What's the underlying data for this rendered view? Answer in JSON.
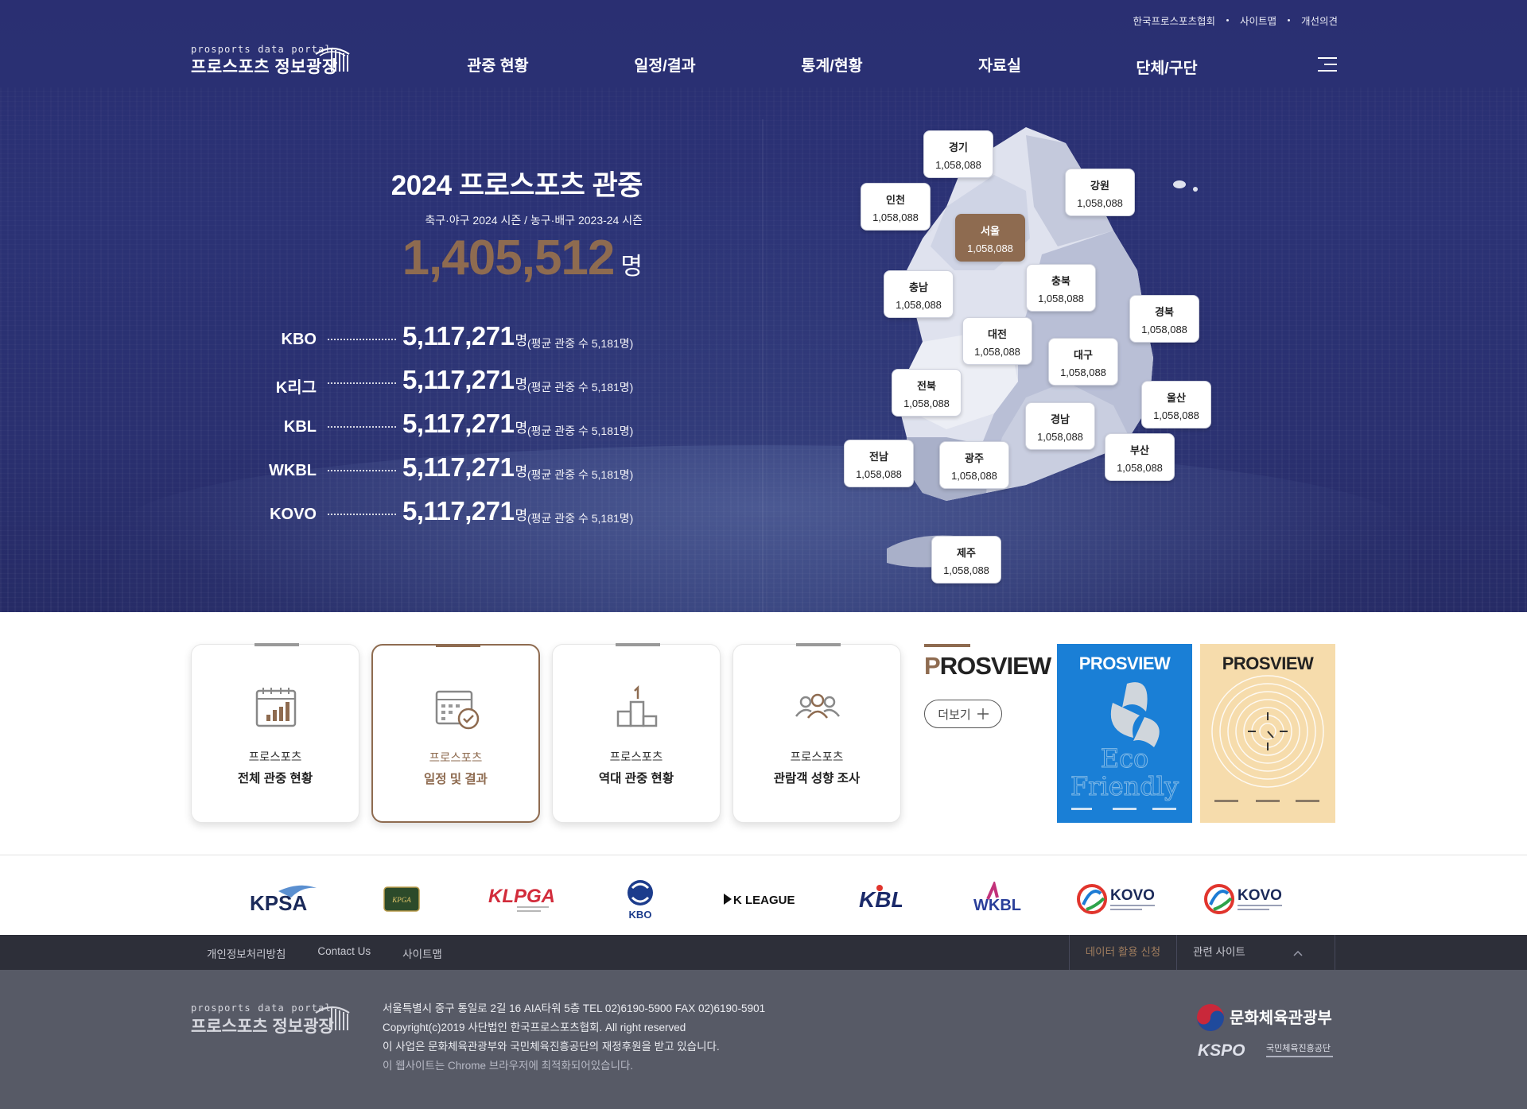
{
  "topbar": {
    "links": [
      "한국프로스포츠협회",
      "사이트맵",
      "개선의견"
    ]
  },
  "logo": {
    "small": "prosports data portal",
    "big": "프로스포츠 정보광장"
  },
  "gnb": [
    "관중 현황",
    "일정/결과",
    "통계/현황",
    "자료실",
    "단체/구단"
  ],
  "hero": {
    "title": "2024 프로스포츠 관중",
    "subtitle": "축구·야구 2024 시즌 / 농구·배구 2023-24 시즌",
    "total": "1,405,512",
    "total_unit": "명",
    "leagues": [
      {
        "name": "KBO",
        "value": "5,117,271",
        "unit": "명",
        "avg": "(평균 관중 수  5,181명)"
      },
      {
        "name": "K리그",
        "value": "5,117,271",
        "unit": "명",
        "avg": "(평균 관중 수  5,181명)"
      },
      {
        "name": "KBL",
        "value": "5,117,271",
        "unit": "명",
        "avg": "(평균 관중 수  5,181명)"
      },
      {
        "name": "WKBL",
        "value": "5,117,271",
        "unit": "명",
        "avg": "(평균 관중 수  5,181명)"
      },
      {
        "name": "KOVO",
        "value": "5,117,271",
        "unit": "명",
        "avg": "(평균 관중 수  5,181명)"
      }
    ],
    "regions": [
      {
        "name": "경기",
        "value": "1,058,088"
      },
      {
        "name": "강원",
        "value": "1,058,088"
      },
      {
        "name": "인천",
        "value": "1,058,088"
      },
      {
        "name": "서울",
        "value": "1,058,088",
        "active": true
      },
      {
        "name": "충남",
        "value": "1,058,088"
      },
      {
        "name": "충북",
        "value": "1,058,088"
      },
      {
        "name": "경북",
        "value": "1,058,088"
      },
      {
        "name": "대전",
        "value": "1,058,088"
      },
      {
        "name": "대구",
        "value": "1,058,088"
      },
      {
        "name": "전북",
        "value": "1,058,088"
      },
      {
        "name": "울산",
        "value": "1,058,088"
      },
      {
        "name": "경남",
        "value": "1,058,088"
      },
      {
        "name": "전남",
        "value": "1,058,088"
      },
      {
        "name": "광주",
        "value": "1,058,088"
      },
      {
        "name": "부산",
        "value": "1,058,088"
      },
      {
        "name": "제주",
        "value": "1,058,088"
      }
    ]
  },
  "quick_menu": [
    {
      "line1": "프로스포츠",
      "line2": "전체 관중 현황",
      "icon": "bar-chart-icon"
    },
    {
      "line1": "프로스포츠",
      "line2": "일정 및 결과",
      "icon": "calendar-check-icon",
      "active": true
    },
    {
      "line1": "프로스포츠",
      "line2": "역대 관중 현황",
      "icon": "podium-icon"
    },
    {
      "line1": "프로스포츠",
      "line2": "관람객 성향 조사",
      "icon": "people-icon"
    }
  ],
  "prosview": {
    "title_first": "P",
    "title_rest": "ROSVIEW",
    "more": "더보기",
    "magazines": [
      {
        "title": "PROSVIEW",
        "cover_text": "Eco Friendly",
        "bg": "#1a7fd6"
      },
      {
        "title": "PROSVIEW",
        "bg": "#f6dcac"
      }
    ]
  },
  "partners": [
    "KPSA",
    "KPGA",
    "KLPGA",
    "KBO",
    "K LEAGUE",
    "KBL",
    "WKBL",
    "KOVO",
    "KOVO"
  ],
  "footer_nav": {
    "links": [
      "개인정보처리방침",
      "Contact Us",
      "사이트맵"
    ],
    "data_apply": "데이터 활용 신청",
    "related": "관련 사이트"
  },
  "footer": {
    "address": "서울특별시 중구 통일로 2길 16 AIA타워 5층 TEL 02)6190-5900 FAX 02)6190-5901",
    "copyright": "Copyright(c)2019 사단법인 한국프로스포츠협회. All right reserved",
    "sponsor": "이 사업은 문화체육관광부와 국민체육진흥공단의 재정후원을 받고 있습니다.",
    "browser_note": "이 웹사이트는 Chrome 브라우저에 최적화되어있습니다.",
    "gov1": "문화체육관광부",
    "gov2": "국민체육진흥공단",
    "gov2_en": "KSPO"
  },
  "colors": {
    "navy": "#2b3275",
    "accent": "#8e6b50",
    "footer_dark": "#2d2f39",
    "footer": "#575a66"
  }
}
